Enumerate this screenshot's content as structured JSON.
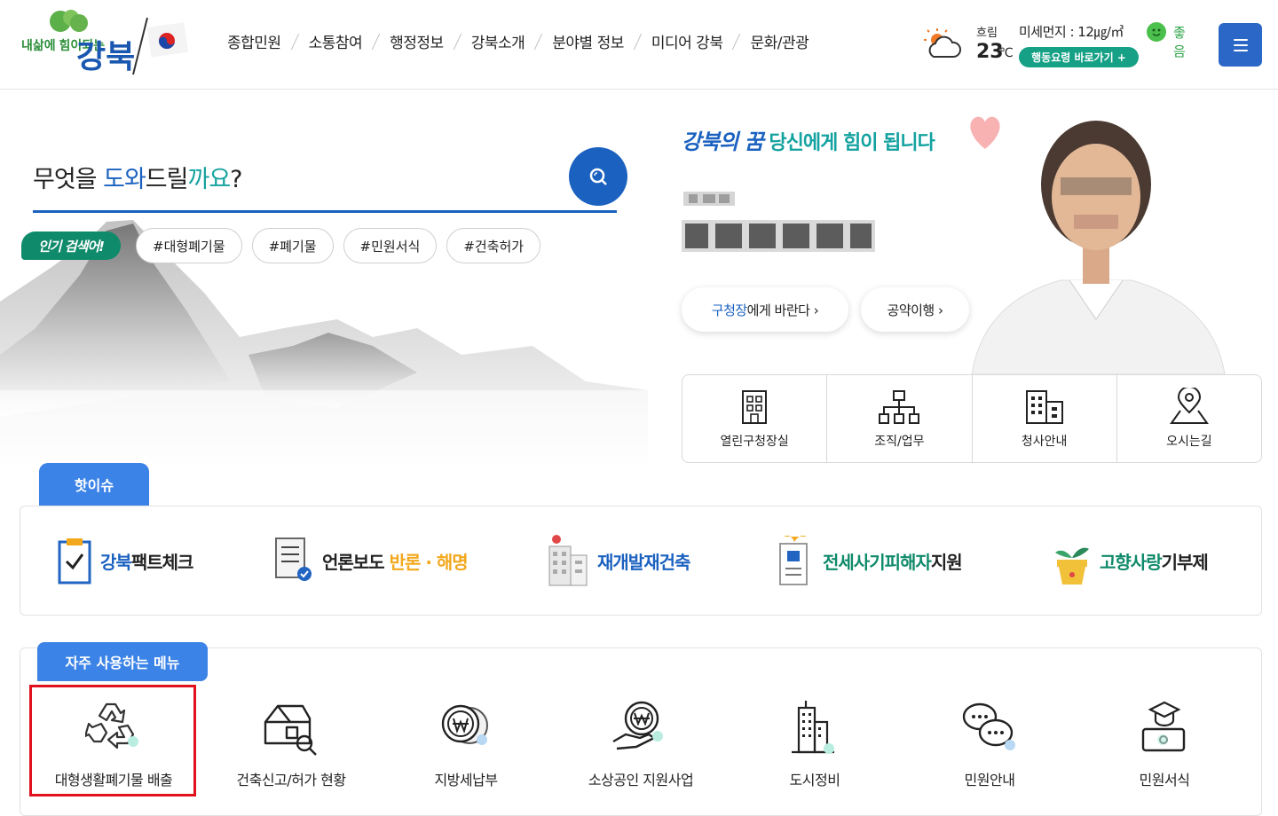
{
  "header": {
    "logo_text_small": "내삶에 힘이되는",
    "logo_text_big": "강북",
    "nav": [
      "종합민원",
      "소통참여",
      "행정정보",
      "강북소개",
      "분야별 정보",
      "미디어 강북",
      "문화/관광"
    ],
    "weather": {
      "condition": "흐림",
      "temperature": "23",
      "unit": "℃",
      "dust_label": "미세먼지 : 12㎍/㎥",
      "dust_status": "좋음",
      "guide_button": "행동요령 바로가기 +"
    }
  },
  "search": {
    "title_parts": [
      "무엇을 ",
      "도와",
      "드릴",
      "까요",
      "?"
    ],
    "popular_badge": "인기 검색어!",
    "tags": [
      "#대형폐기물",
      "#폐기물",
      "#민원서식",
      "#건축허가"
    ]
  },
  "mayor": {
    "slogan_brand": "강북의 꿈",
    "slogan_text": "당신에게 힘이 됩니다",
    "buttons": [
      {
        "highlight": "구청장",
        "rest": "에게 바란다 ›"
      },
      {
        "highlight": "",
        "rest": "공약이행 ›"
      }
    ],
    "quick_links": [
      "열린구청장실",
      "조직/업무",
      "청사안내",
      "오시는길"
    ]
  },
  "hot_issue": {
    "tab_label": "핫이슈",
    "items": [
      {
        "parts": [
          "강북",
          "팩트체크"
        ]
      },
      {
        "parts": [
          "언론보도 ",
          "반론 · 해명"
        ]
      },
      {
        "parts": [
          "재개발재건축"
        ]
      },
      {
        "parts": [
          "전세사기피해자",
          "지원"
        ]
      },
      {
        "parts": [
          "고향사랑",
          "기부제"
        ]
      }
    ]
  },
  "frequent_menu": {
    "tab_label": "자주 사용하는 메뉴",
    "items": [
      "대형생활폐기물 배출",
      "건축신고/허가 현황",
      "지방세납부",
      "소상공인 지원사업",
      "도시정비",
      "민원안내",
      "민원서식"
    ]
  },
  "colors": {
    "primary": "#1b62c0",
    "teal": "#14a2a0",
    "green": "#0f8a6a",
    "highlight_box": "#e0101c"
  }
}
